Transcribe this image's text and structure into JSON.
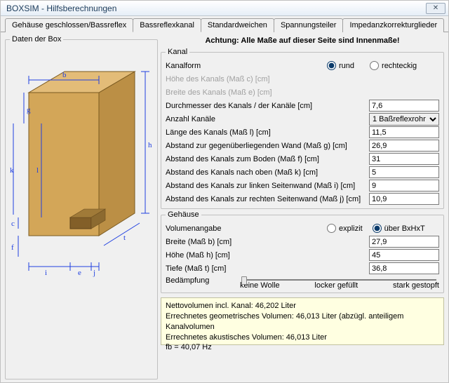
{
  "window": {
    "title": "BOXSIM - Hilfsberechnungen",
    "close": "✕"
  },
  "tabs": [
    {
      "label": "Gehäuse geschlossen/Bassreflex"
    },
    {
      "label": "Bassreflexkanal"
    },
    {
      "label": "Standardweichen"
    },
    {
      "label": "Spannungsteiler"
    },
    {
      "label": "Impedanzkorrekturglieder"
    }
  ],
  "activeTab": 1,
  "left": {
    "legend": "Daten der Box"
  },
  "warning": "Achtung: Alle Maße auf dieser Seite sind Innenmaße!",
  "kanal": {
    "legend": "Kanal",
    "form_label": "Kanalform",
    "form_rund": "rund",
    "form_rechteckig": "rechteckig",
    "hoehe_label": "Höhe des Kanals (Maß c) [cm]",
    "breite_label": "Breite des Kanals (Maß e) [cm]",
    "durchmesser_label": "Durchmesser des Kanals / der Kanäle [cm]",
    "durchmesser_val": "7,6",
    "anzahl_label": "Anzahl Kanäle",
    "anzahl_val": "1 Baßreflexrohr",
    "laenge_label": "Länge des Kanals (Maß l) [cm]",
    "laenge_val": "11,5",
    "abstand_wall_label": "Abstand zur gegenüberliegenden Wand (Maß g) [cm]",
    "abstand_wall_val": "26,9",
    "abstand_boden_label": "Abstand des Kanals zum Boden (Maß f) [cm]",
    "abstand_boden_val": "31",
    "abstand_oben_label": "Abstand des Kanals nach oben (Maß k) [cm]",
    "abstand_oben_val": "5",
    "abstand_links_label": "Abstand des Kanals zur linken Seitenwand (Maß i) [cm]",
    "abstand_links_val": "9",
    "abstand_rechts_label": "Abstand des Kanals zur rechten Seitenwand (Maß j) [cm]",
    "abstand_rechts_val": "10,9"
  },
  "gehause": {
    "legend": "Gehäuse",
    "vol_label": "Volumenangabe",
    "vol_explizit": "explizit",
    "vol_bxhxt": "über BxHxT",
    "breite_label": "Breite (Maß b) [cm]",
    "breite_val": "27,9",
    "hoehe_label": "Höhe (Maß h) [cm]",
    "hoehe_val": "45",
    "tiefe_label": "Tiefe (Maß t) [cm]",
    "tiefe_val": "36,8",
    "bedampfung_label": "Bedämpfung",
    "d0": "keine Wolle",
    "d1": "locker gefüllt",
    "d2": "stark gestopft"
  },
  "results": {
    "l1": "Nettovolumen incl. Kanal: 46,202 Liter",
    "l2": "Errechnetes geometrisches Volumen: 46,013 Liter (abzügl. anteiligem Kanalvolumen",
    "l3": "Errechnetes akustisches Volumen: 46,013 Liter",
    "l4": "fb = 40,07 Hz"
  },
  "dim_labels": {
    "b": "b",
    "h": "h",
    "t": "t",
    "g": "g",
    "k": "k",
    "l": "l",
    "c": "c",
    "f": "f",
    "i": "i",
    "e": "e",
    "j": "j"
  }
}
